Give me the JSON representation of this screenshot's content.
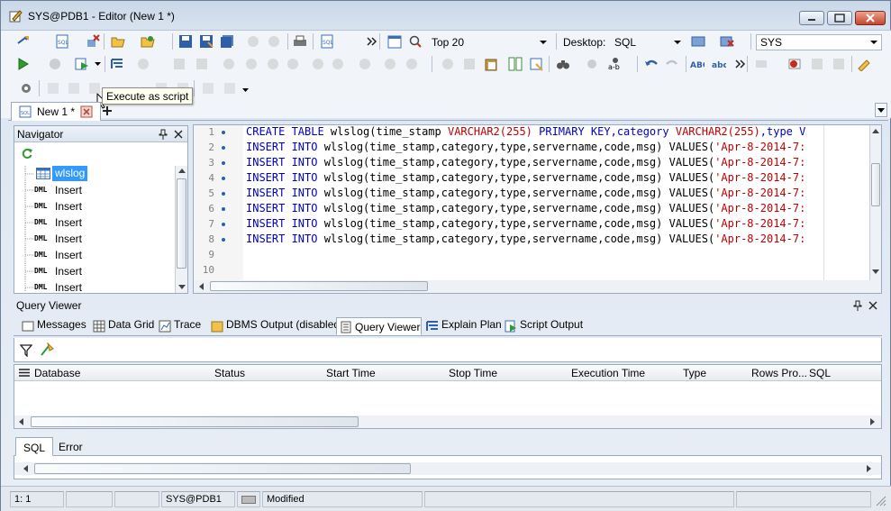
{
  "window": {
    "title": "SYS@PDB1 - Editor (New 1 *)"
  },
  "toolbar": {
    "top_n": "Top 20",
    "desktop_label": "Desktop:",
    "desktop_value": "SQL",
    "connection": "SYS"
  },
  "tooltip": {
    "text": "Execute as script"
  },
  "editor_tab": {
    "label": "New 1 *"
  },
  "navigator": {
    "title": "Navigator",
    "items": [
      {
        "badge": "",
        "label": "wlslog"
      },
      {
        "badge": "DML",
        "label": "Insert"
      },
      {
        "badge": "DML",
        "label": "Insert"
      },
      {
        "badge": "DML",
        "label": "Insert"
      },
      {
        "badge": "DML",
        "label": "Insert"
      },
      {
        "badge": "DML",
        "label": "Insert"
      },
      {
        "badge": "DML",
        "label": "Insert"
      },
      {
        "badge": "DML",
        "label": "Insert"
      }
    ]
  },
  "code": {
    "line_numbers": [
      "1",
      "2",
      "3",
      "4",
      "5",
      "6",
      "7",
      "8",
      "9",
      "10"
    ],
    "create_line": {
      "kw1": "CREATE TABLE ",
      "t1": "wlslog(time_stamp ",
      "ty1": "VARCHAR2(255)",
      "kw2": " PRIMARY KEY,",
      "t2": "category ",
      "ty2": "VARCHAR2(255)",
      "t3": ",type V"
    },
    "insert_line": {
      "kw1": "INSERT INTO ",
      "t1": "wlslog(time_stamp,category,type,servername,code,msg) ",
      "kw2": "VALUES(",
      "s1": "'Apr-8-2014-7:"
    }
  },
  "query_viewer": {
    "title": "Query Viewer",
    "tabs": [
      "Messages",
      "Data Grid",
      "Trace",
      "DBMS Output (disabled)",
      "Query Viewer",
      "Explain Plan",
      "Script Output"
    ],
    "active_tab": "Query Viewer",
    "columns": [
      "Database",
      "Status",
      "Start Time",
      "Stop Time",
      "Execution Time",
      "Type",
      "Rows Pro...",
      "SQL"
    ]
  },
  "bottom_tabs": [
    "SQL",
    "Error"
  ],
  "status": {
    "position": "1:   1",
    "connection": "SYS@PDB1",
    "state": "Modified"
  },
  "colors": {
    "keyword": "#0000c0",
    "string": "#c00000",
    "selection": "#3399ff"
  }
}
